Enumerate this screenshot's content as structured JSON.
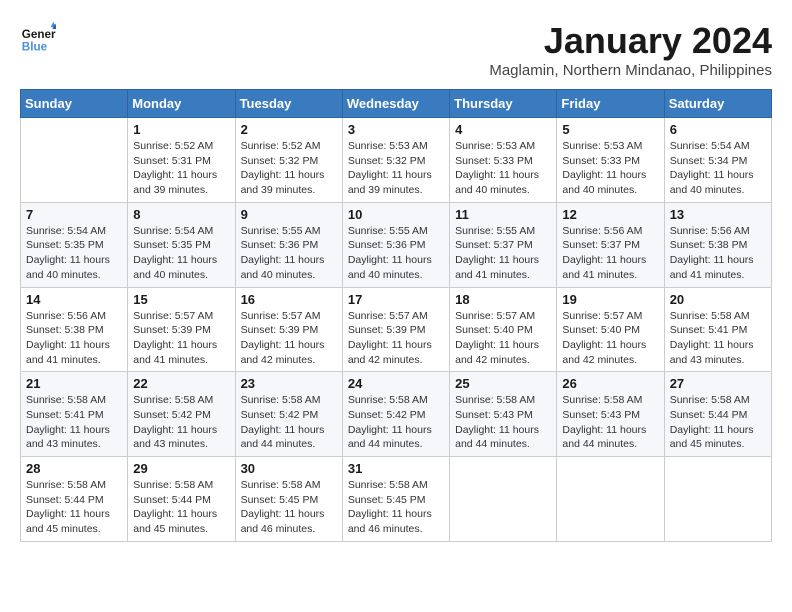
{
  "header": {
    "logo_line1": "General",
    "logo_line2": "Blue",
    "title": "January 2024",
    "subtitle": "Maglamin, Northern Mindanao, Philippines"
  },
  "weekdays": [
    "Sunday",
    "Monday",
    "Tuesday",
    "Wednesday",
    "Thursday",
    "Friday",
    "Saturday"
  ],
  "weeks": [
    [
      {
        "num": "",
        "detail": ""
      },
      {
        "num": "1",
        "detail": "Sunrise: 5:52 AM\nSunset: 5:31 PM\nDaylight: 11 hours\nand 39 minutes."
      },
      {
        "num": "2",
        "detail": "Sunrise: 5:52 AM\nSunset: 5:32 PM\nDaylight: 11 hours\nand 39 minutes."
      },
      {
        "num": "3",
        "detail": "Sunrise: 5:53 AM\nSunset: 5:32 PM\nDaylight: 11 hours\nand 39 minutes."
      },
      {
        "num": "4",
        "detail": "Sunrise: 5:53 AM\nSunset: 5:33 PM\nDaylight: 11 hours\nand 40 minutes."
      },
      {
        "num": "5",
        "detail": "Sunrise: 5:53 AM\nSunset: 5:33 PM\nDaylight: 11 hours\nand 40 minutes."
      },
      {
        "num": "6",
        "detail": "Sunrise: 5:54 AM\nSunset: 5:34 PM\nDaylight: 11 hours\nand 40 minutes."
      }
    ],
    [
      {
        "num": "7",
        "detail": "Sunrise: 5:54 AM\nSunset: 5:35 PM\nDaylight: 11 hours\nand 40 minutes."
      },
      {
        "num": "8",
        "detail": "Sunrise: 5:54 AM\nSunset: 5:35 PM\nDaylight: 11 hours\nand 40 minutes."
      },
      {
        "num": "9",
        "detail": "Sunrise: 5:55 AM\nSunset: 5:36 PM\nDaylight: 11 hours\nand 40 minutes."
      },
      {
        "num": "10",
        "detail": "Sunrise: 5:55 AM\nSunset: 5:36 PM\nDaylight: 11 hours\nand 40 minutes."
      },
      {
        "num": "11",
        "detail": "Sunrise: 5:55 AM\nSunset: 5:37 PM\nDaylight: 11 hours\nand 41 minutes."
      },
      {
        "num": "12",
        "detail": "Sunrise: 5:56 AM\nSunset: 5:37 PM\nDaylight: 11 hours\nand 41 minutes."
      },
      {
        "num": "13",
        "detail": "Sunrise: 5:56 AM\nSunset: 5:38 PM\nDaylight: 11 hours\nand 41 minutes."
      }
    ],
    [
      {
        "num": "14",
        "detail": "Sunrise: 5:56 AM\nSunset: 5:38 PM\nDaylight: 11 hours\nand 41 minutes."
      },
      {
        "num": "15",
        "detail": "Sunrise: 5:57 AM\nSunset: 5:39 PM\nDaylight: 11 hours\nand 41 minutes."
      },
      {
        "num": "16",
        "detail": "Sunrise: 5:57 AM\nSunset: 5:39 PM\nDaylight: 11 hours\nand 42 minutes."
      },
      {
        "num": "17",
        "detail": "Sunrise: 5:57 AM\nSunset: 5:39 PM\nDaylight: 11 hours\nand 42 minutes."
      },
      {
        "num": "18",
        "detail": "Sunrise: 5:57 AM\nSunset: 5:40 PM\nDaylight: 11 hours\nand 42 minutes."
      },
      {
        "num": "19",
        "detail": "Sunrise: 5:57 AM\nSunset: 5:40 PM\nDaylight: 11 hours\nand 42 minutes."
      },
      {
        "num": "20",
        "detail": "Sunrise: 5:58 AM\nSunset: 5:41 PM\nDaylight: 11 hours\nand 43 minutes."
      }
    ],
    [
      {
        "num": "21",
        "detail": "Sunrise: 5:58 AM\nSunset: 5:41 PM\nDaylight: 11 hours\nand 43 minutes."
      },
      {
        "num": "22",
        "detail": "Sunrise: 5:58 AM\nSunset: 5:42 PM\nDaylight: 11 hours\nand 43 minutes."
      },
      {
        "num": "23",
        "detail": "Sunrise: 5:58 AM\nSunset: 5:42 PM\nDaylight: 11 hours\nand 44 minutes."
      },
      {
        "num": "24",
        "detail": "Sunrise: 5:58 AM\nSunset: 5:42 PM\nDaylight: 11 hours\nand 44 minutes."
      },
      {
        "num": "25",
        "detail": "Sunrise: 5:58 AM\nSunset: 5:43 PM\nDaylight: 11 hours\nand 44 minutes."
      },
      {
        "num": "26",
        "detail": "Sunrise: 5:58 AM\nSunset: 5:43 PM\nDaylight: 11 hours\nand 44 minutes."
      },
      {
        "num": "27",
        "detail": "Sunrise: 5:58 AM\nSunset: 5:44 PM\nDaylight: 11 hours\nand 45 minutes."
      }
    ],
    [
      {
        "num": "28",
        "detail": "Sunrise: 5:58 AM\nSunset: 5:44 PM\nDaylight: 11 hours\nand 45 minutes."
      },
      {
        "num": "29",
        "detail": "Sunrise: 5:58 AM\nSunset: 5:44 PM\nDaylight: 11 hours\nand 45 minutes."
      },
      {
        "num": "30",
        "detail": "Sunrise: 5:58 AM\nSunset: 5:45 PM\nDaylight: 11 hours\nand 46 minutes."
      },
      {
        "num": "31",
        "detail": "Sunrise: 5:58 AM\nSunset: 5:45 PM\nDaylight: 11 hours\nand 46 minutes."
      },
      {
        "num": "",
        "detail": ""
      },
      {
        "num": "",
        "detail": ""
      },
      {
        "num": "",
        "detail": ""
      }
    ]
  ]
}
